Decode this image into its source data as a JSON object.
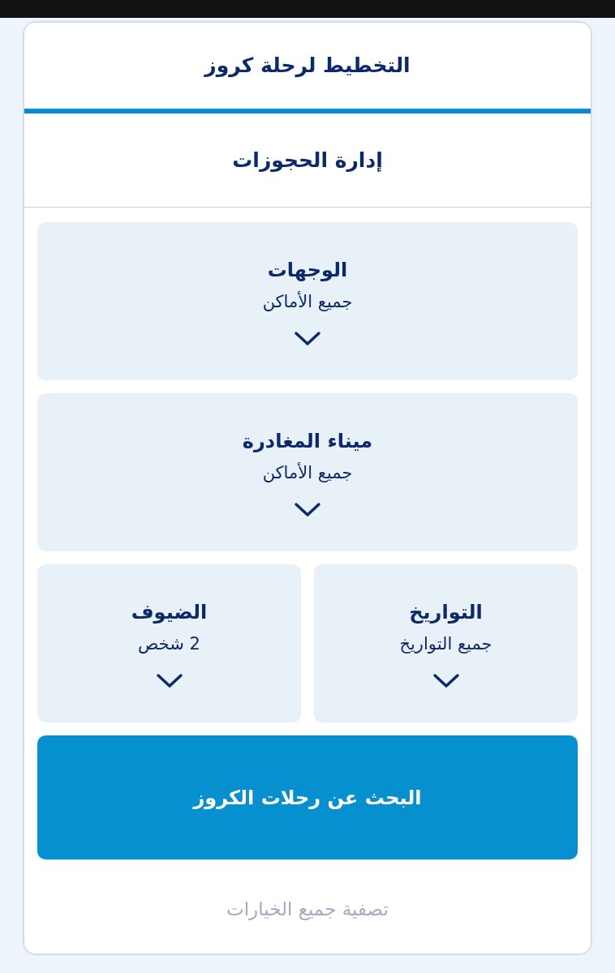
{
  "tabs": [
    {
      "label": "التخطيط لرحلة كروز",
      "selected": true
    },
    {
      "label": "إدارة الحجوزات",
      "selected": false
    }
  ],
  "filter_rows": [
    [
      {
        "label": "الوجهات",
        "value": "جميع الأماكن"
      }
    ],
    [
      {
        "label": "ميناء المغادرة",
        "value": "جميع الأماكن"
      }
    ],
    [
      {
        "label": "التواريخ",
        "value": "جميع التواريخ"
      },
      {
        "label": "الضيوف",
        "value": "2 شخص"
      }
    ]
  ],
  "search_button": "البحث عن رحلات الكروز",
  "clear_link": "تصفية جميع الخيارات"
}
